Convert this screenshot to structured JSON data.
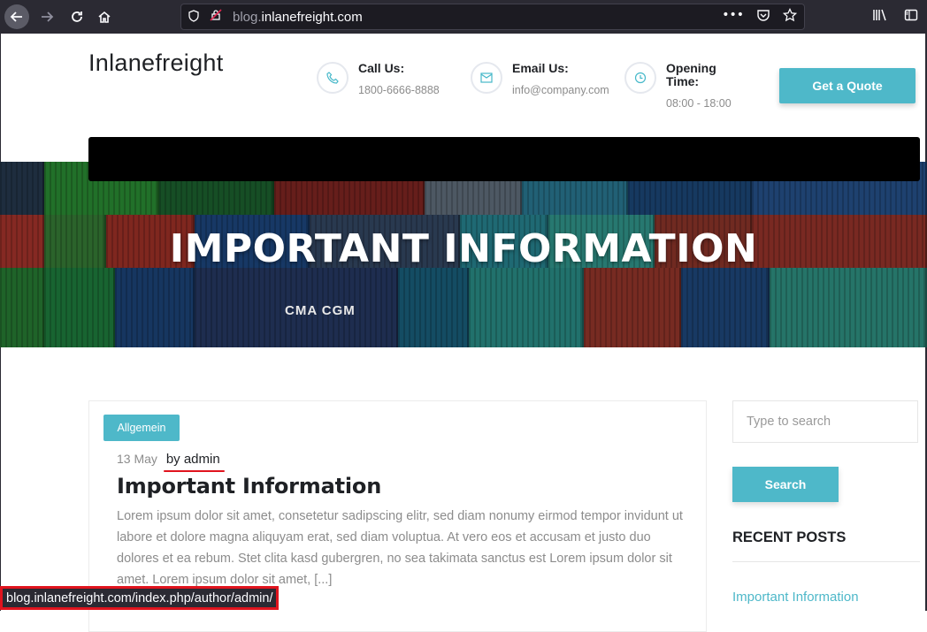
{
  "browser": {
    "url_prefix": "blog.",
    "url_domain": "inlanefreight.com",
    "menu_dots": "•••",
    "status_url": "blog.inlanefreight.com/index.php/author/admin/"
  },
  "header": {
    "brand": "Inlanefreight",
    "call_title": "Call Us:",
    "call_value": "1800-6666-8888",
    "email_title": "Email Us:",
    "email_value": "info@company.com",
    "hours_title_line1": "Opening",
    "hours_title_line2": "Time:",
    "hours_value": "08:00 - 18:00",
    "quote_button": "Get a Quote"
  },
  "hero": {
    "title": "IMPORTANT INFORMATION",
    "container_text": "CMA CGM"
  },
  "post": {
    "category": "Allgemein",
    "date": "13 May",
    "author": "by admin",
    "title": "Important Information",
    "excerpt": "Lorem ipsum dolor sit amet, consetetur sadipscing elitr, sed diam nonumy eirmod tempor invidunt ut labore et dolore magna aliquyam erat, sed diam voluptua. At vero eos et accusam et justo duo dolores et ea rebum. Stet clita kasd gubergren, no sea takimata sanctus est Lorem ipsum dolor sit amet. Lorem ipsum dolor sit amet, [...]"
  },
  "sidebar": {
    "search_placeholder": "Type to search",
    "search_button": "Search",
    "recent_heading": "RECENT POSTS",
    "recent_items": [
      "Important Information"
    ]
  },
  "colors": {
    "accent": "#4eb8c9",
    "annotation": "#e0141e",
    "chrome": "#2b2a33"
  }
}
